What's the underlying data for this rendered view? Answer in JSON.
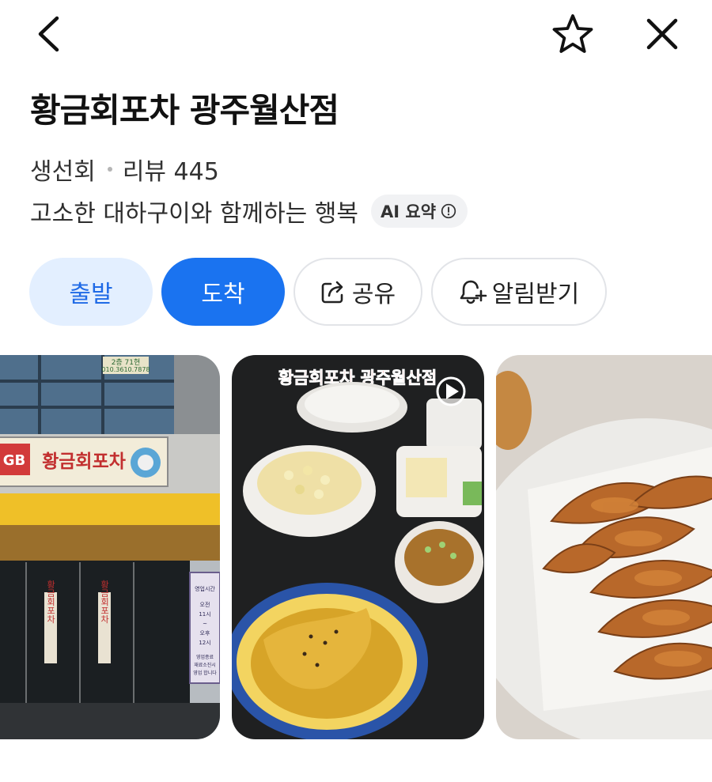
{
  "topbar": {
    "back_icon": "chevron-left-icon",
    "favorite_icon": "star-outline-icon",
    "close_icon": "close-icon"
  },
  "place": {
    "name": "황금회포차 광주월산점",
    "category": "생선회",
    "reviews": "리뷰 445",
    "summary": "고소한 대하구이와 함께하는 행복",
    "ai_badge": "AI 요약"
  },
  "actions": {
    "depart": "출발",
    "arrive": "도착",
    "share": "공유",
    "notify": "알림받기"
  },
  "photos": {
    "storefront": {
      "sign": "황금회포차",
      "sign_logo": "GB",
      "phone_plate_line1": "2층 71현",
      "phone_plate_line2": "010.3610.7878",
      "door_text": "황금회포차",
      "hours_poster": [
        "영업시간",
        "오전",
        "11시",
        "~",
        "오후",
        "12시",
        "영업종료",
        "재료소진시",
        "영업 합니다"
      ]
    },
    "food_overlay": "황금회포차 광주월산점",
    "has_video": true
  },
  "colors": {
    "accent": "#1a73f0",
    "accent_light": "#e3efff",
    "overlay_text": "#ff3b3b"
  }
}
